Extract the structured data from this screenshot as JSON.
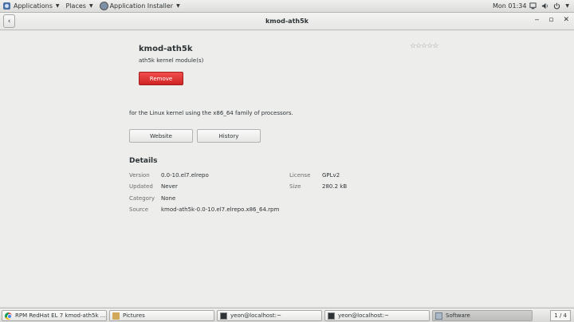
{
  "top_panel": {
    "applications": "Applications",
    "places": "Places",
    "installer": "Application Installer",
    "clock": "Mon 01:34"
  },
  "header": {
    "title": "kmod-ath5k"
  },
  "app": {
    "name": "kmod-ath5k",
    "summary": "ath5k kernel module(s)",
    "remove_label": "Remove",
    "description": "for the Linux kernel using the x86_64 family of processors.",
    "website_label": "Website",
    "history_label": "History",
    "rating_stars": 0
  },
  "details": {
    "heading": "Details",
    "left": [
      {
        "label": "Version",
        "value": "0.0-10.el7.elrepo"
      },
      {
        "label": "Updated",
        "value": "Never"
      },
      {
        "label": "Category",
        "value": "None"
      },
      {
        "label": "Source",
        "value": "kmod-ath5k-0.0-10.el7.elrepo.x86_64.rpm"
      }
    ],
    "right": [
      {
        "label": "License",
        "value": "GPLv2"
      },
      {
        "label": "Size",
        "value": "280.2 kB"
      }
    ]
  },
  "taskbar": {
    "tasks": [
      {
        "label": "RPM RedHat EL 7 kmod-ath5k ...",
        "icon": "chrome-icon"
      },
      {
        "label": "Pictures",
        "icon": "folder-icon"
      },
      {
        "label": "yeon@localhost:~",
        "icon": "terminal-icon"
      },
      {
        "label": "yeon@localhost:~",
        "icon": "terminal-icon"
      },
      {
        "label": "Software",
        "icon": "software-icon"
      }
    ],
    "workspace": "1 / 4"
  }
}
